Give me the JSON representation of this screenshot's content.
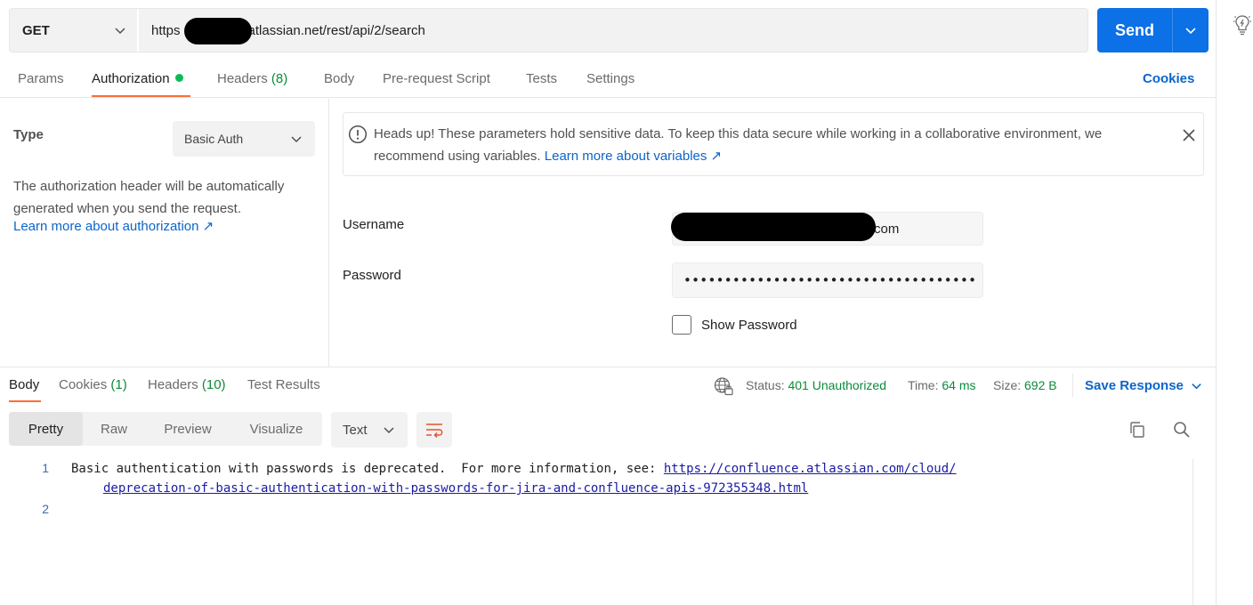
{
  "request": {
    "method": "GET",
    "url": "https://██████atlassian.net/rest/api/2/search",
    "url_prefix": "https",
    "url_suffix": "atlassian.net/rest/api/2/search",
    "send_label": "Send"
  },
  "request_tabs": {
    "params": "Params",
    "authorization": "Authorization",
    "headers": "Headers",
    "headers_count": "(8)",
    "body": "Body",
    "prerequest": "Pre-request Script",
    "tests": "Tests",
    "settings": "Settings",
    "cookies": "Cookies"
  },
  "auth": {
    "type_label": "Type",
    "type_value": "Basic Auth",
    "description": "The authorization header will be automatically generated when you send the request.",
    "learn_more": "Learn more about authorization ↗",
    "notice_text": "Heads up! These parameters hold sensitive data. To keep this data secure while working in a collaborative environment, we recommend using variables.",
    "notice_link": "Learn more about variables ↗",
    "username_label": "Username",
    "username_value": "com",
    "password_label": "Password",
    "password_value": "••••••••••••••••••••••••••••••••••••",
    "show_password": "Show Password"
  },
  "response": {
    "tabs": {
      "body": "Body",
      "cookies": "Cookies",
      "cookies_count": "(1)",
      "headers": "Headers",
      "headers_count": "(10)",
      "test_results": "Test Results"
    },
    "status_label": "Status:",
    "status_value": "401 Unauthorized",
    "time_label": "Time:",
    "time_value": "64 ms",
    "size_label": "Size:",
    "size_value": "692 B",
    "save_response": "Save Response",
    "views": [
      "Pretty",
      "Raw",
      "Preview",
      "Visualize"
    ],
    "active_view": "Pretty",
    "format": "Text",
    "lines": {
      "n1": "1",
      "n2": "2",
      "text1": "Basic authentication with passwords is deprecated.  For more information, see: ",
      "link1": "https://confluence.atlassian.com/cloud/",
      "link2": "deprecation-of-basic-authentication-with-passwords-for-jira-and-confluence-apis-972355348.html"
    }
  },
  "colors": {
    "accent": "#ff6c37",
    "send_blue": "#0c70e6",
    "link_blue": "#0c65c9",
    "success_green": "#0c8a3a"
  }
}
